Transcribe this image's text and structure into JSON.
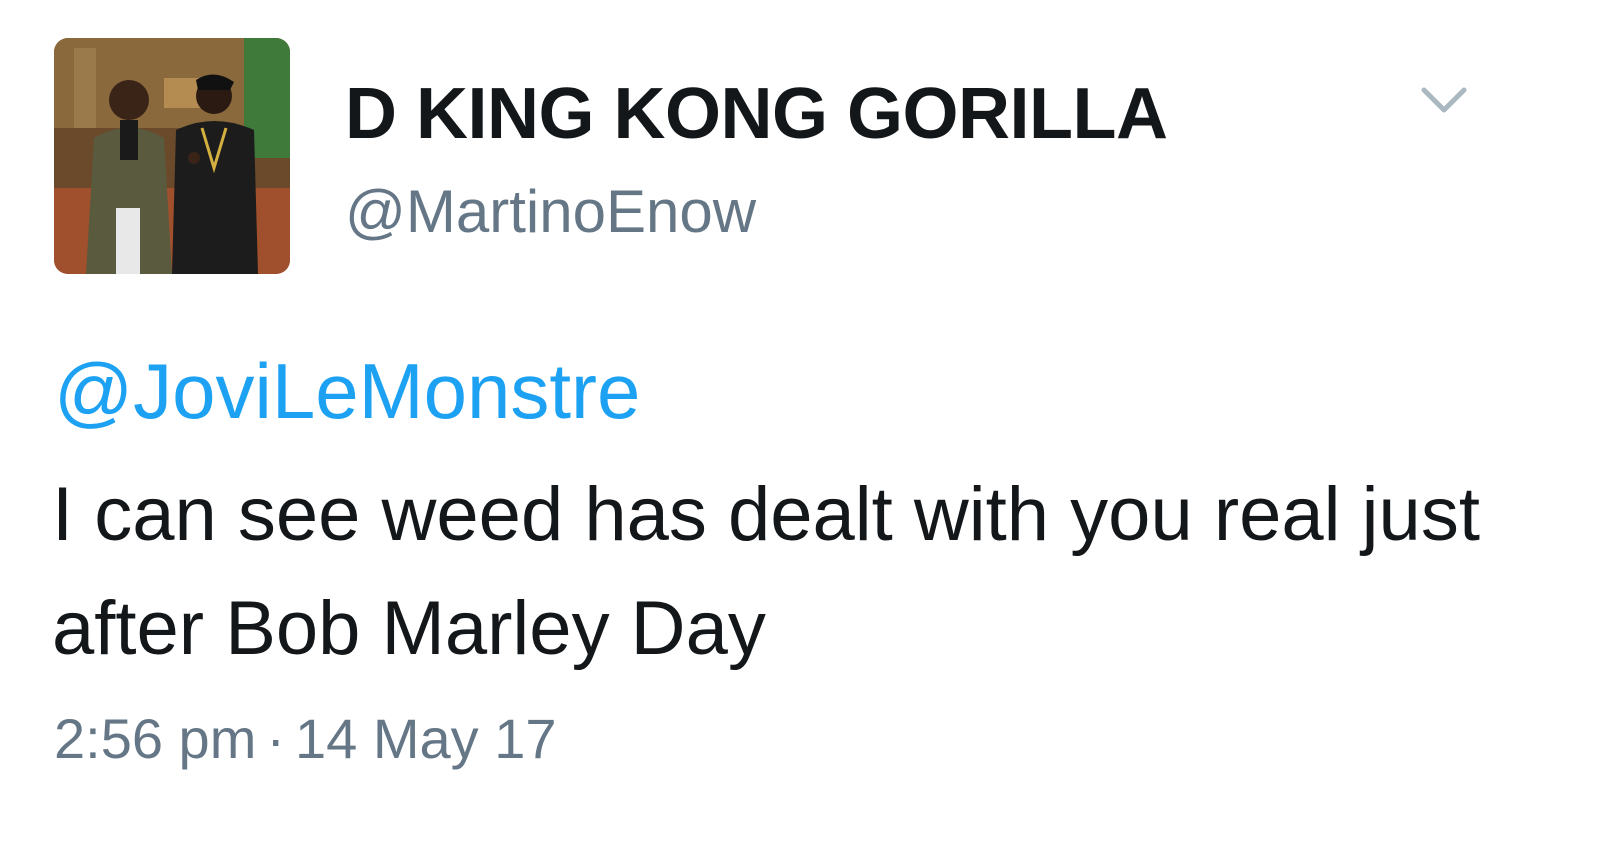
{
  "tweet": {
    "display_name": "D KING KONG GORILLA",
    "handle": "@MartinoEnow",
    "mention": "@JoviLeMonstre",
    "text": "I can see weed has dealt with you real just after Bob Marley Day",
    "time": "2:56 pm",
    "separator": "·",
    "date": "14 May 17"
  },
  "icons": {
    "menu": "chevron-down-icon",
    "avatar": "profile-photo"
  },
  "colors": {
    "name": "#14171a",
    "secondary": "#657786",
    "link": "#1da1f2",
    "caret": "#aab8c2"
  }
}
